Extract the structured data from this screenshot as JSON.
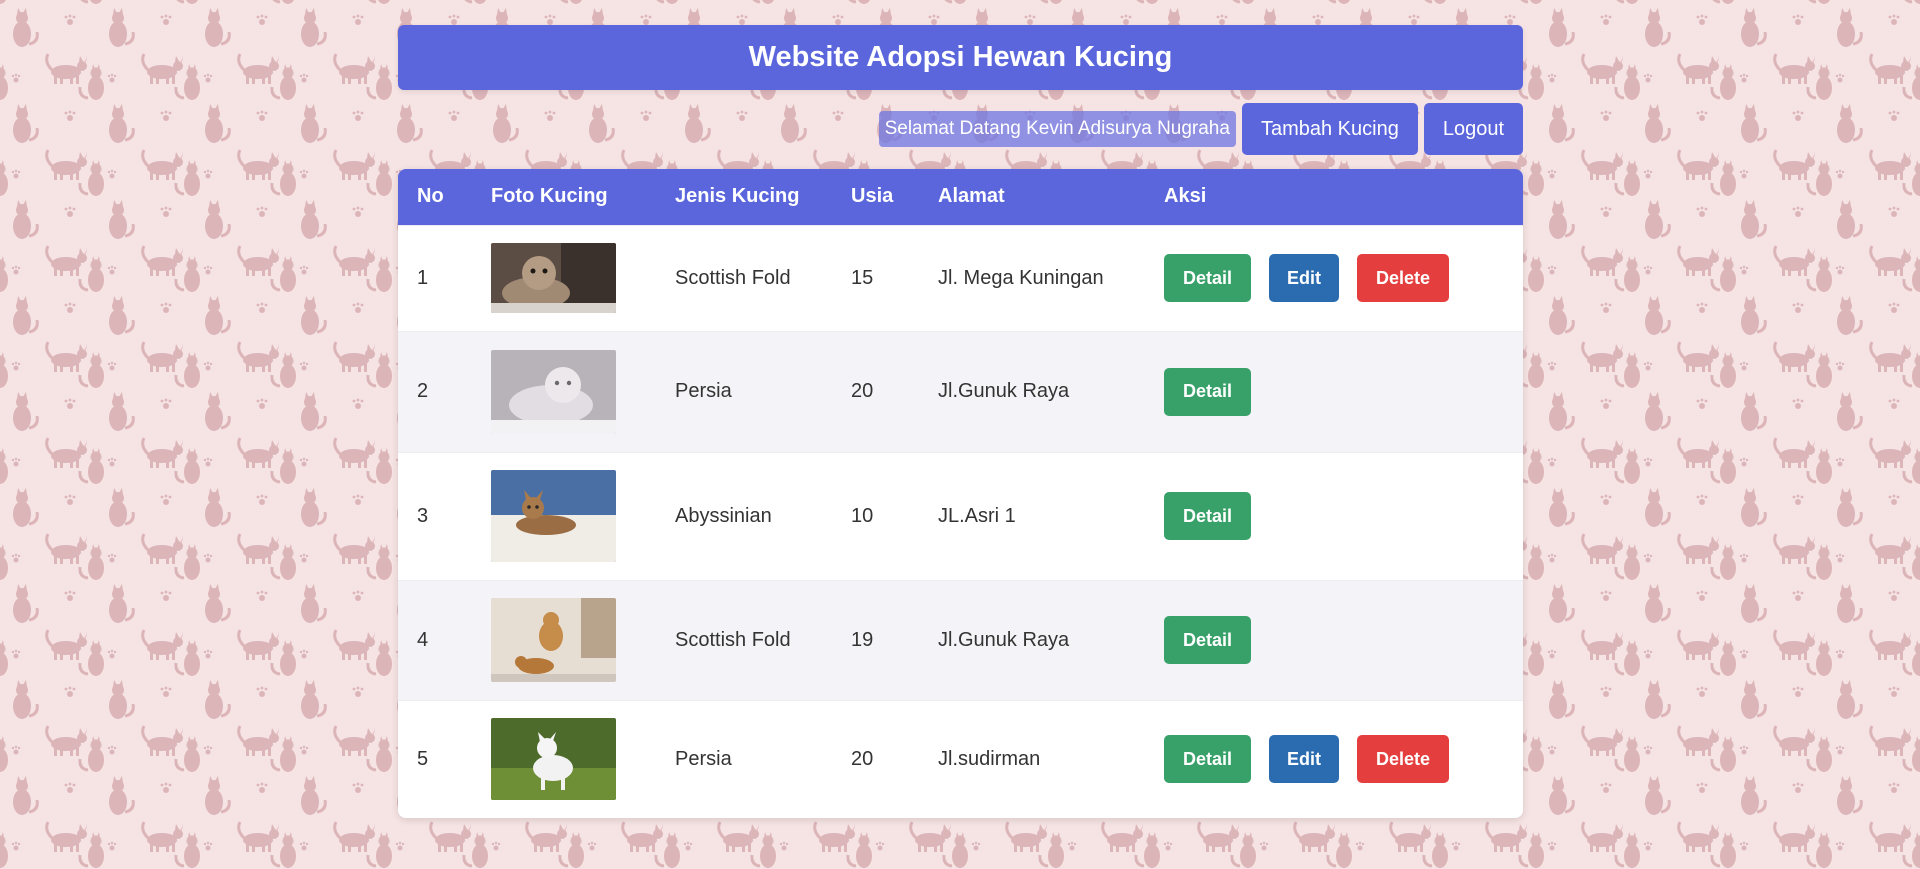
{
  "header": {
    "title": "Website Adopsi Hewan Kucing"
  },
  "topbar": {
    "welcome_text": "Selamat Datang Kevin Adisurya Nugraha",
    "add_label": "Tambah Kucing",
    "logout_label": "Logout"
  },
  "table": {
    "headers": [
      "No",
      "Foto Kucing",
      "Jenis Kucing",
      "Usia",
      "Alamat",
      "Aksi"
    ],
    "rows": [
      {
        "no": "1",
        "jenis": "Scottish Fold",
        "usia": "15",
        "alamat": "Jl. Mega Kuningan",
        "actions": [
          "Detail",
          "Edit",
          "Delete"
        ]
      },
      {
        "no": "2",
        "jenis": "Persia",
        "usia": "20",
        "alamat": "Jl.Gunuk Raya",
        "actions": [
          "Detail"
        ]
      },
      {
        "no": "3",
        "jenis": "Abyssinian",
        "usia": "10",
        "alamat": "JL.Asri 1",
        "actions": [
          "Detail"
        ]
      },
      {
        "no": "4",
        "jenis": "Scottish Fold",
        "usia": "19",
        "alamat": "Jl.Gunuk Raya",
        "actions": [
          "Detail"
        ]
      },
      {
        "no": "5",
        "jenis": "Persia",
        "usia": "20",
        "alamat": "Jl.sudirman",
        "actions": [
          "Detail",
          "Edit",
          "Delete"
        ]
      }
    ]
  },
  "colors": {
    "primary": "#5b66dd",
    "detail": "#38a169",
    "edit": "#2b6cb0",
    "delete": "#e53e3e",
    "background": "#f6e3e3",
    "pattern": "#dcb5b9"
  }
}
